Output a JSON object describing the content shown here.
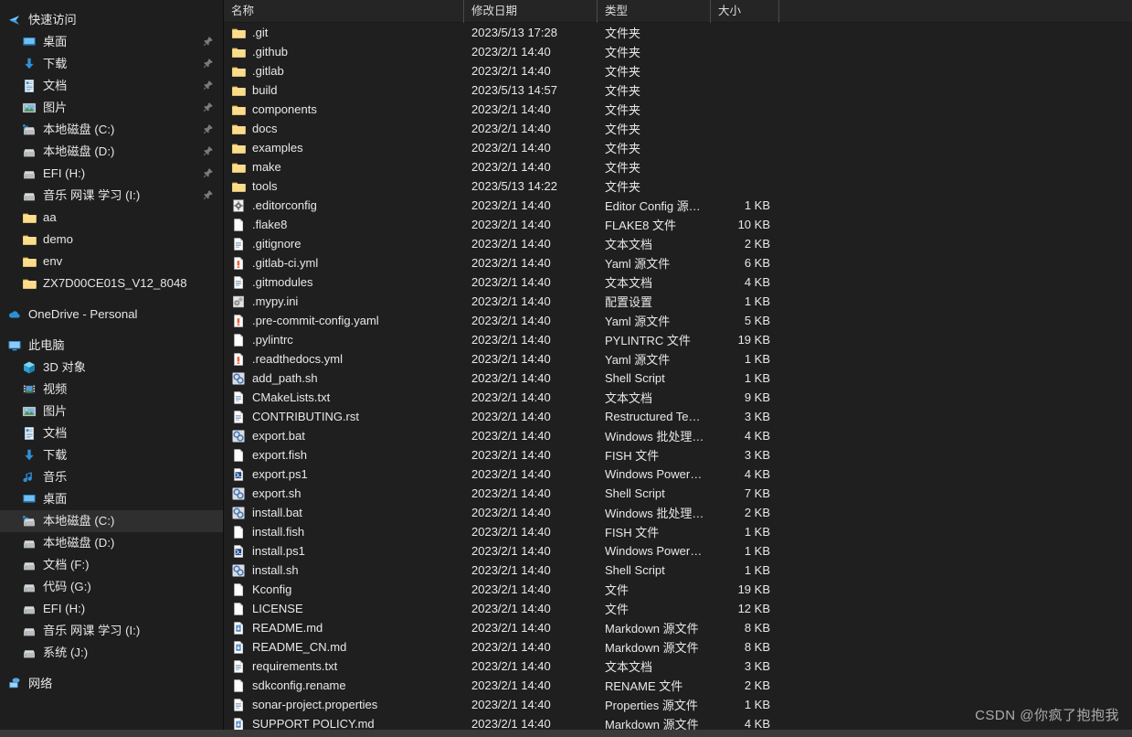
{
  "sidebar": {
    "quick_access": {
      "label": "快速访问",
      "icon": "star-icon"
    },
    "quick_items": [
      {
        "label": "桌面",
        "icon": "desktop-icon",
        "pinned": true
      },
      {
        "label": "下载",
        "icon": "download-icon",
        "pinned": true
      },
      {
        "label": "文档",
        "icon": "documents-icon",
        "pinned": true
      },
      {
        "label": "图片",
        "icon": "pictures-icon",
        "pinned": true
      },
      {
        "label": "本地磁盘 (C:)",
        "icon": "drive-system-icon",
        "pinned": true
      },
      {
        "label": "本地磁盘 (D:)",
        "icon": "drive-icon",
        "pinned": true
      },
      {
        "label": "EFI (H:)",
        "icon": "drive-icon",
        "pinned": true
      },
      {
        "label": "音乐 网课 学习 (I:)",
        "icon": "drive-icon",
        "pinned": true
      },
      {
        "label": "aa",
        "icon": "folder-icon",
        "pinned": false
      },
      {
        "label": "demo",
        "icon": "folder-icon",
        "pinned": false
      },
      {
        "label": "env",
        "icon": "folder-icon",
        "pinned": false
      },
      {
        "label": "ZX7D00CE01S_V12_8048",
        "icon": "folder-icon",
        "pinned": false
      }
    ],
    "onedrive": {
      "label": "OneDrive - Personal",
      "icon": "cloud-icon"
    },
    "this_pc": {
      "label": "此电脑",
      "icon": "computer-icon"
    },
    "this_pc_items": [
      {
        "label": "3D 对象",
        "icon": "3d-objects-icon",
        "selected": false
      },
      {
        "label": "视频",
        "icon": "videos-icon",
        "selected": false
      },
      {
        "label": "图片",
        "icon": "pictures-icon",
        "selected": false
      },
      {
        "label": "文档",
        "icon": "documents-icon",
        "selected": false
      },
      {
        "label": "下载",
        "icon": "download-icon",
        "selected": false
      },
      {
        "label": "音乐",
        "icon": "music-icon",
        "selected": false
      },
      {
        "label": "桌面",
        "icon": "desktop-icon",
        "selected": false
      },
      {
        "label": "本地磁盘 (C:)",
        "icon": "drive-system-icon",
        "selected": true
      },
      {
        "label": "本地磁盘 (D:)",
        "icon": "drive-icon",
        "selected": false
      },
      {
        "label": "文档 (F:)",
        "icon": "drive-icon",
        "selected": false
      },
      {
        "label": "代码 (G:)",
        "icon": "drive-icon",
        "selected": false
      },
      {
        "label": "EFI (H:)",
        "icon": "drive-icon",
        "selected": false
      },
      {
        "label": "音乐 网课 学习 (I:)",
        "icon": "drive-icon",
        "selected": false
      },
      {
        "label": "系统 (J:)",
        "icon": "drive-icon",
        "selected": false
      }
    ],
    "network": {
      "label": "网络",
      "icon": "network-icon"
    }
  },
  "columns": {
    "name": "名称",
    "date": "修改日期",
    "type": "类型",
    "size": "大小"
  },
  "files": [
    {
      "name": ".git",
      "date": "2023/5/13 17:28",
      "type": "文件夹",
      "size": "",
      "icon": "folder-icon"
    },
    {
      "name": ".github",
      "date": "2023/2/1 14:40",
      "type": "文件夹",
      "size": "",
      "icon": "folder-icon"
    },
    {
      "name": ".gitlab",
      "date": "2023/2/1 14:40",
      "type": "文件夹",
      "size": "",
      "icon": "folder-icon"
    },
    {
      "name": "build",
      "date": "2023/5/13 14:57",
      "type": "文件夹",
      "size": "",
      "icon": "folder-icon"
    },
    {
      "name": "components",
      "date": "2023/2/1 14:40",
      "type": "文件夹",
      "size": "",
      "icon": "folder-icon"
    },
    {
      "name": "docs",
      "date": "2023/2/1 14:40",
      "type": "文件夹",
      "size": "",
      "icon": "folder-icon"
    },
    {
      "name": "examples",
      "date": "2023/2/1 14:40",
      "type": "文件夹",
      "size": "",
      "icon": "folder-icon"
    },
    {
      "name": "make",
      "date": "2023/2/1 14:40",
      "type": "文件夹",
      "size": "",
      "icon": "folder-icon"
    },
    {
      "name": "tools",
      "date": "2023/5/13 14:22",
      "type": "文件夹",
      "size": "",
      "icon": "folder-icon"
    },
    {
      "name": ".editorconfig",
      "date": "2023/2/1 14:40",
      "type": "Editor Config 源…",
      "size": "1 KB",
      "icon": "gear-file-icon"
    },
    {
      "name": ".flake8",
      "date": "2023/2/1 14:40",
      "type": "FLAKE8 文件",
      "size": "10 KB",
      "icon": "blank-file-icon"
    },
    {
      "name": ".gitignore",
      "date": "2023/2/1 14:40",
      "type": "文本文档",
      "size": "2 KB",
      "icon": "text-file-icon"
    },
    {
      "name": ".gitlab-ci.yml",
      "date": "2023/2/1 14:40",
      "type": "Yaml 源文件",
      "size": "6 KB",
      "icon": "yaml-file-icon"
    },
    {
      "name": ".gitmodules",
      "date": "2023/2/1 14:40",
      "type": "文本文档",
      "size": "4 KB",
      "icon": "text-file-icon"
    },
    {
      "name": ".mypy.ini",
      "date": "2023/2/1 14:40",
      "type": "配置设置",
      "size": "1 KB",
      "icon": "config-file-icon"
    },
    {
      "name": ".pre-commit-config.yaml",
      "date": "2023/2/1 14:40",
      "type": "Yaml 源文件",
      "size": "5 KB",
      "icon": "yaml-file-icon"
    },
    {
      "name": ".pylintrc",
      "date": "2023/2/1 14:40",
      "type": "PYLINTRC 文件",
      "size": "19 KB",
      "icon": "blank-file-icon"
    },
    {
      "name": ".readthedocs.yml",
      "date": "2023/2/1 14:40",
      "type": "Yaml 源文件",
      "size": "1 KB",
      "icon": "yaml-file-icon"
    },
    {
      "name": "add_path.sh",
      "date": "2023/2/1 14:40",
      "type": "Shell Script",
      "size": "1 KB",
      "icon": "shell-script-icon"
    },
    {
      "name": "CMakeLists.txt",
      "date": "2023/2/1 14:40",
      "type": "文本文档",
      "size": "9 KB",
      "icon": "text-file-icon"
    },
    {
      "name": "CONTRIBUTING.rst",
      "date": "2023/2/1 14:40",
      "type": "Restructured Te…",
      "size": "3 KB",
      "icon": "text-file-icon"
    },
    {
      "name": "export.bat",
      "date": "2023/2/1 14:40",
      "type": "Windows 批处理…",
      "size": "4 KB",
      "icon": "shell-script-icon"
    },
    {
      "name": "export.fish",
      "date": "2023/2/1 14:40",
      "type": "FISH 文件",
      "size": "3 KB",
      "icon": "blank-file-icon"
    },
    {
      "name": "export.ps1",
      "date": "2023/2/1 14:40",
      "type": "Windows Power…",
      "size": "4 KB",
      "icon": "powershell-file-icon"
    },
    {
      "name": "export.sh",
      "date": "2023/2/1 14:40",
      "type": "Shell Script",
      "size": "7 KB",
      "icon": "shell-script-icon"
    },
    {
      "name": "install.bat",
      "date": "2023/2/1 14:40",
      "type": "Windows 批处理…",
      "size": "2 KB",
      "icon": "shell-script-icon"
    },
    {
      "name": "install.fish",
      "date": "2023/2/1 14:40",
      "type": "FISH 文件",
      "size": "1 KB",
      "icon": "blank-file-icon"
    },
    {
      "name": "install.ps1",
      "date": "2023/2/1 14:40",
      "type": "Windows Power…",
      "size": "1 KB",
      "icon": "powershell-file-icon"
    },
    {
      "name": "install.sh",
      "date": "2023/2/1 14:40",
      "type": "Shell Script",
      "size": "1 KB",
      "icon": "shell-script-icon"
    },
    {
      "name": "Kconfig",
      "date": "2023/2/1 14:40",
      "type": "文件",
      "size": "19 KB",
      "icon": "blank-file-icon"
    },
    {
      "name": "LICENSE",
      "date": "2023/2/1 14:40",
      "type": "文件",
      "size": "12 KB",
      "icon": "blank-file-icon"
    },
    {
      "name": "README.md",
      "date": "2023/2/1 14:40",
      "type": "Markdown 源文件",
      "size": "8 KB",
      "icon": "markdown-file-icon"
    },
    {
      "name": "README_CN.md",
      "date": "2023/2/1 14:40",
      "type": "Markdown 源文件",
      "size": "8 KB",
      "icon": "markdown-file-icon"
    },
    {
      "name": "requirements.txt",
      "date": "2023/2/1 14:40",
      "type": "文本文档",
      "size": "3 KB",
      "icon": "text-file-icon"
    },
    {
      "name": "sdkconfig.rename",
      "date": "2023/2/1 14:40",
      "type": "RENAME 文件",
      "size": "2 KB",
      "icon": "blank-file-icon"
    },
    {
      "name": "sonar-project.properties",
      "date": "2023/2/1 14:40",
      "type": "Properties 源文件",
      "size": "1 KB",
      "icon": "text-file-icon"
    },
    {
      "name": "SUPPORT POLICY.md",
      "date": "2023/2/1 14:40",
      "type": "Markdown 源文件",
      "size": "4 KB",
      "icon": "markdown-file-icon"
    }
  ],
  "watermark": "CSDN @你疯了抱抱我",
  "colors": {
    "background": "#1f1f1f",
    "sidebar_background": "#1e1e1e",
    "header_background": "#252526",
    "selected_row": "#2f2f2f",
    "text": "#e8e8e8",
    "folder": "#f5cf70",
    "accent_blue": "#4a9ede"
  }
}
